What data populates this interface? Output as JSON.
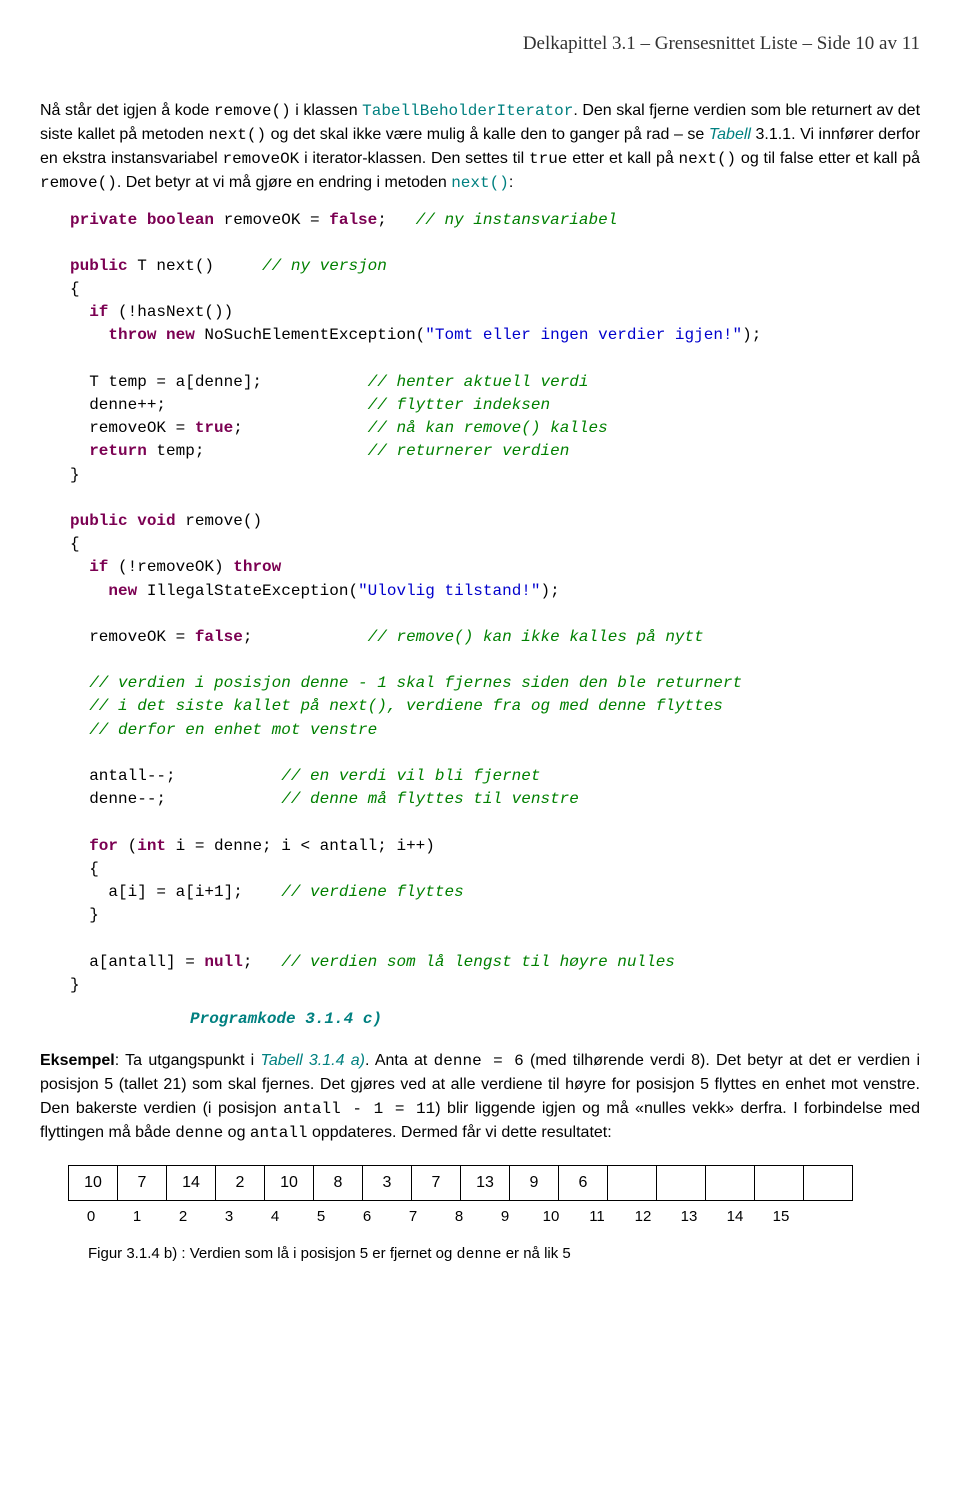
{
  "header": {
    "chapter": "Delkapittel 3.1",
    "sep1": " – ",
    "title": "Grensesnittet Liste",
    "sep2": " – ",
    "page_prefix": "Side ",
    "page_num": "10 av 11"
  },
  "para1": {
    "t1": "Nå står det igjen å kode ",
    "code1": "remove()",
    "t2": " i klassen ",
    "cls": "TabellBeholderIterator",
    "t3": ". Den skal fjerne verdien som ble returnert av det siste kallet på metoden ",
    "code2": "next()",
    "t4": " og det skal ikke være mulig å kalle den to ganger på rad – se ",
    "ref": "Tabell",
    "t5": " 3.1.1. Vi innfører derfor en ekstra instansvariabel ",
    "code3": "removeOK",
    "t6": " i iterator-klassen. Den settes til ",
    "code4": "true",
    "t7": " etter et kall på ",
    "code5": "next()",
    "t8": " og til false etter et kall på ",
    "code6": "remove()",
    "t9": ". Det betyr at vi må gjøre en endring i metoden ",
    "code7": "next()",
    "t10": ":"
  },
  "code": {
    "l01a": "private",
    "l01b": " boolean",
    "l01c": " removeOK = ",
    "l01d": "false",
    "l01e": ";   ",
    "l01f": "// ny instansvariabel",
    "l03a": "public",
    "l03b": " T next()     ",
    "l03c": "// ny versjon",
    "l04": "{",
    "l05a": "  if",
    "l05b": " (!hasNext())",
    "l06a": "    throw",
    "l06b": " new",
    "l06c": " NoSuchElementException(",
    "l06d": "\"Tomt eller ingen verdier igjen!\"",
    "l06e": ");",
    "l08a": "  T temp = a[denne];           ",
    "l08b": "// henter aktuell verdi",
    "l09a": "  denne++;                     ",
    "l09b": "// flytter indeksen",
    "l10a": "  removeOK = ",
    "l10b": "true",
    "l10c": ";             ",
    "l10d": "// nå kan remove() kalles",
    "l11a": "  return",
    "l11b": " temp;                 ",
    "l11c": "// returnerer verdien",
    "l12": "}",
    "l14a": "public",
    "l14b": " void",
    "l14c": " remove()",
    "l15": "{",
    "l16a": "  if",
    "l16b": " (!removeOK) ",
    "l16c": "throw",
    "l17a": "    new",
    "l17b": " IllegalStateException(",
    "l17c": "\"Ulovlig tilstand!\"",
    "l17d": ");",
    "l19a": "  removeOK = ",
    "l19b": "false",
    "l19c": ";            ",
    "l19d": "// remove() kan ikke kalles på nytt",
    "l21": "  // verdien i posisjon denne - 1 skal fjernes siden den ble returnert",
    "l22": "  // i det siste kallet på next(), verdiene fra og med denne flyttes",
    "l23": "  // derfor en enhet mot venstre",
    "l25a": "  antall--;           ",
    "l25b": "// en verdi vil bli fjernet",
    "l26a": "  denne--;            ",
    "l26b": "// denne må flyttes til venstre",
    "l28a": "  for",
    "l28b": " (",
    "l28c": "int",
    "l28d": " i = denne; i < antall; i++)",
    "l29": "  {",
    "l30a": "    a[i] = a[i+1];    ",
    "l30b": "// verdiene flyttes",
    "l31": "  }",
    "l33a": "  a[antall] = ",
    "l33b": "null",
    "l33c": ";   ",
    "l33d": "// verdien som lå lengst til høyre nulles",
    "l34": "}",
    "caption": "Programkode 3.1.4 c)"
  },
  "para2": {
    "bold": "Eksempel",
    "t1": ": Ta utgangspunkt i ",
    "ref": "Tabell 3.1.4 a)",
    "t2": ". Anta at ",
    "code1": "denne = 6",
    "t3": " (med tilhørende verdi 8). Det betyr at det er verdien i posisjon 5 (tallet 21) som skal fjernes. Det gjøres ved at alle verdiene til høyre for posisjon 5 flyttes en enhet mot venstre. Den bakerste verdien (i posisjon ",
    "code2": "antall - 1 = 11",
    "t4": ") blir liggende igjen og må «nulles vekk» derfra. I forbindelse med flyttingen må både ",
    "code3": "denne",
    "t5": " og ",
    "code4": "antall",
    "t6": " oppdateres. Dermed får vi dette resultatet:"
  },
  "table": {
    "values": [
      "10",
      "7",
      "14",
      "2",
      "10",
      "8",
      "3",
      "7",
      "13",
      "9",
      "6",
      "",
      "",
      "",
      "",
      ""
    ],
    "indices": [
      "0",
      "1",
      "2",
      "3",
      "4",
      "5",
      "6",
      "7",
      "8",
      "9",
      "10",
      "11",
      "12",
      "13",
      "14",
      "15"
    ]
  },
  "fig": {
    "t1": "Figur 3.1.4 b) : Verdien som lå i posisjon 5 er fjernet og ",
    "code": "denne",
    "t2": " er nå lik 5"
  }
}
